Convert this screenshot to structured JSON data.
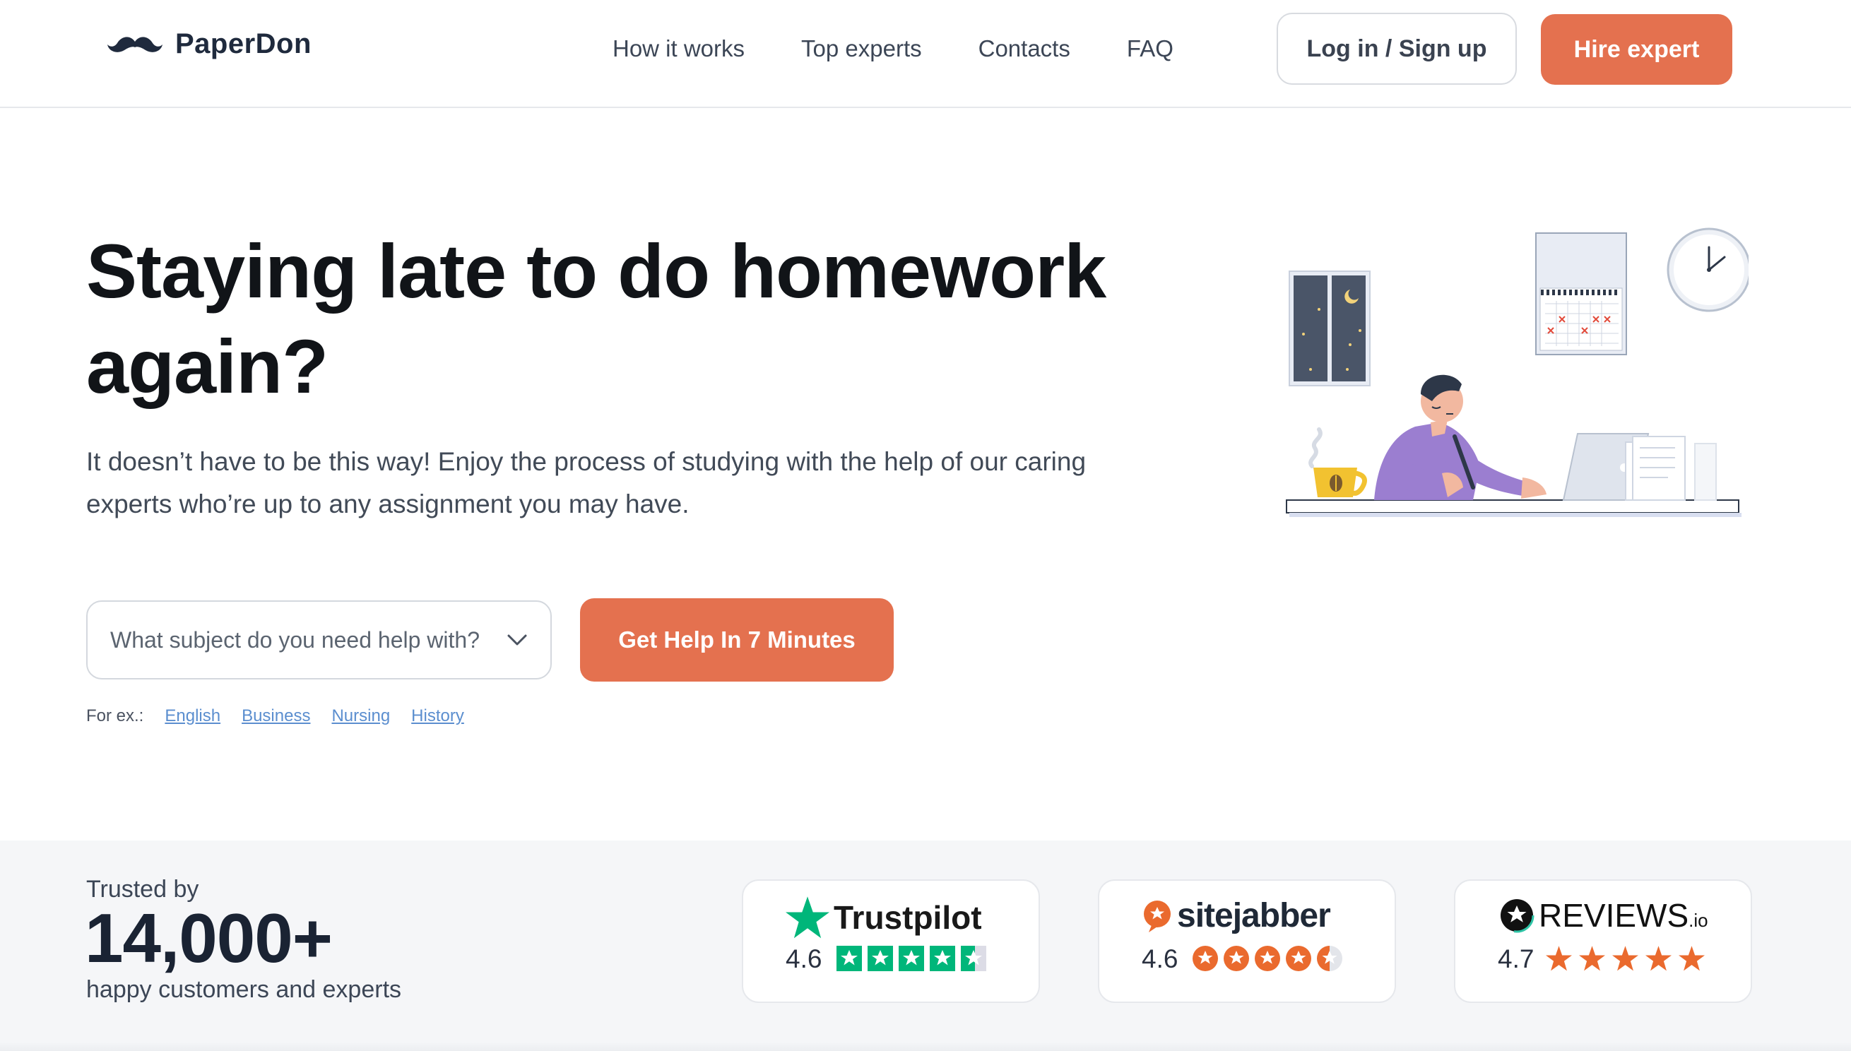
{
  "header": {
    "logo_text": "PaperDon",
    "nav": [
      "How it works",
      "Top experts",
      "Contacts",
      "FAQ"
    ],
    "login_label": "Log in / Sign up",
    "hire_label": "Hire expert"
  },
  "hero": {
    "title": "Staying late to do homework again?",
    "subtitle": "It doesn’t have to be this way! Enjoy the process of studying with the help of our caring experts who’re up to any assignment you may have.",
    "subject_placeholder": "What subject do you need help with?",
    "cta_label": "Get Help In 7 Minutes",
    "examples_label": "For ex.:",
    "examples": [
      "English",
      "Business",
      "Nursing",
      "History"
    ]
  },
  "trust": {
    "trusted_by": "Trusted by",
    "count": "14,000+",
    "caption": "happy customers and experts",
    "reviews": [
      {
        "brand": "Trustpilot",
        "rating": "4.6",
        "rating_value": 4.6,
        "star_color": "#00b67a"
      },
      {
        "brand": "sitejabber",
        "rating": "4.6",
        "rating_value": 4.6,
        "star_color": "#ea6a2e"
      },
      {
        "brand": "REVIEWS",
        "brand_suffix": ".io",
        "rating": "4.7",
        "rating_value": 4.7,
        "star_color": "#ea6a2e"
      }
    ]
  },
  "colors": {
    "accent": "#e4714f",
    "link": "#5b8ecf",
    "dark_text": "#111418"
  },
  "icons": [
    "mustache-logo-icon",
    "chevron-down-icon",
    "trustpilot-star-icon",
    "sitejabber-icon",
    "reviews-io-icon"
  ]
}
